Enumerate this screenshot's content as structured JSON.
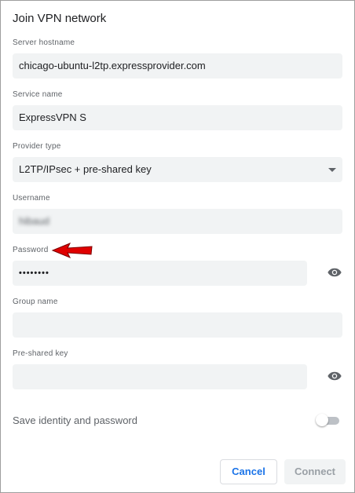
{
  "dialog": {
    "title": "Join VPN network"
  },
  "fields": {
    "server_hostname": {
      "label": "Server hostname",
      "value": "chicago-ubuntu-l2tp.expressprovider.com"
    },
    "service_name": {
      "label": "Service name",
      "value": "ExpressVPN S"
    },
    "provider_type": {
      "label": "Provider type",
      "value": "L2TP/IPsec + pre-shared key"
    },
    "username": {
      "label": "Username",
      "value": "hibaud"
    },
    "password": {
      "label": "Password",
      "value": "••••••••"
    },
    "group_name": {
      "label": "Group name",
      "value": ""
    },
    "pre_shared_key": {
      "label": "Pre-shared key",
      "value": ""
    }
  },
  "save_identity": {
    "label": "Save identity and password",
    "enabled": false
  },
  "buttons": {
    "cancel": "Cancel",
    "connect": "Connect"
  },
  "colors": {
    "accent": "#1a73e8",
    "annotation_arrow": "#e00000",
    "field_bg": "#f1f3f4"
  },
  "icons": {
    "password_visibility": "eye-icon",
    "psk_visibility": "eye-icon",
    "provider_dropdown": "caret-down-icon",
    "annotation": "red-arrow-icon"
  }
}
